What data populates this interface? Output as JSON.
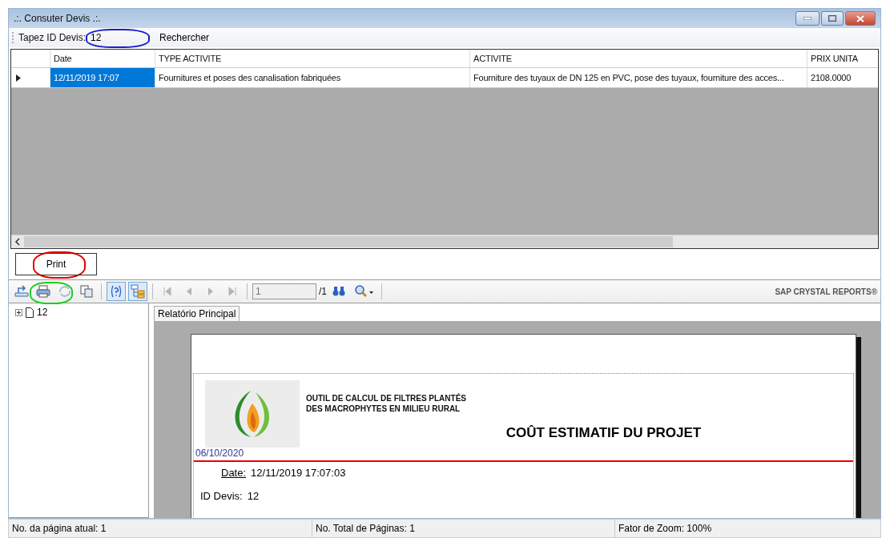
{
  "window": {
    "title": ".:. Consuter Devis .:."
  },
  "search_bar": {
    "label": "Tapez ID Devis:",
    "value": "12",
    "button": "Rechercher"
  },
  "grid": {
    "columns": [
      "Date",
      "TYPE ACTIVITE",
      "ACTIVITE",
      "PRIX UNITA"
    ],
    "rows": [
      {
        "selected": true,
        "cells": [
          "12/11/2019 17:07",
          "Fournitures et poses des canalisation fabriquées",
          "Fourniture des tuyaux de DN 125 en PVC, pose des tuyaux, fourniture des acces...",
          "2108.0000"
        ]
      }
    ]
  },
  "print_button": "Print",
  "viewer_toolbar": {
    "tools": [
      {
        "kind": "export",
        "disabled": false,
        "selected": false
      },
      {
        "kind": "print",
        "disabled": false,
        "selected": false
      },
      {
        "kind": "refresh",
        "disabled": true,
        "selected": false
      },
      {
        "kind": "copy",
        "disabled": false,
        "selected": false
      },
      {
        "kind": "help",
        "disabled": false,
        "selected": true
      },
      {
        "kind": "tree",
        "disabled": false,
        "selected": true
      },
      {
        "kind": "first",
        "disabled": true,
        "selected": false
      },
      {
        "kind": "prev",
        "disabled": true,
        "selected": false
      },
      {
        "kind": "next",
        "disabled": true,
        "selected": false
      },
      {
        "kind": "last",
        "disabled": true,
        "selected": false
      }
    ],
    "page_value": "1",
    "page_total": "/1",
    "brand": "SAP CRYSTAL REPORTS®"
  },
  "group_tree": {
    "items": [
      {
        "label": "12",
        "expanded": false
      }
    ]
  },
  "report_tab": "Relatório Principal",
  "report": {
    "subtitle_lines": [
      "OUTIL DE CALCUL DE FILTRES PLANTÉS",
      "DES MACROPHYTES EN MILIEU RURAL"
    ],
    "title": "COÛT ESTIMATIF DU PROJET",
    "print_date": "06/10/2020",
    "date_label": "Date:",
    "date_value": "12/11/2019   17:07:03",
    "id_label": "ID Devis:",
    "id_value": "12"
  },
  "status_bar": [
    "No. da página atual: 1",
    "No. Total de Páginas: 1",
    "Fator de Zoom: 100%"
  ]
}
